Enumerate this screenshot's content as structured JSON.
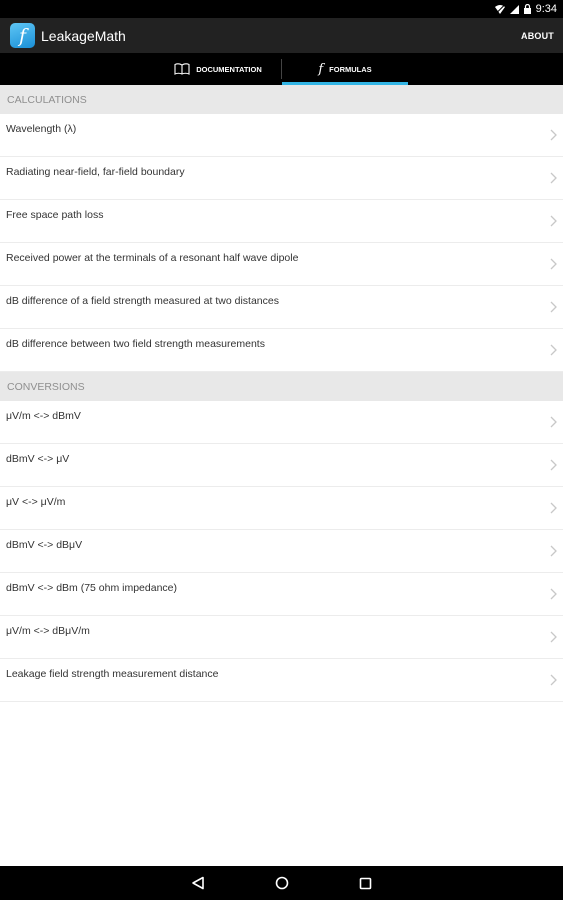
{
  "status_bar": {
    "time": "9:34"
  },
  "app": {
    "icon_letter": "f",
    "title": "LeakageMath",
    "about_label": "ABOUT"
  },
  "tabs": [
    {
      "label": "DOCUMENTATION",
      "icon": "book-icon",
      "selected": false
    },
    {
      "label": "FORMULAS",
      "icon": "function-icon",
      "selected": true
    }
  ],
  "sections": [
    {
      "title": "CALCULATIONS",
      "items": [
        "Wavelength (λ)",
        "Radiating near-field, far-field boundary",
        "Free space path loss",
        "Received power at the terminals of a resonant half wave dipole",
        "dB difference of a field strength measured at two distances",
        "dB difference between two field strength measurements"
      ]
    },
    {
      "title": "CONVERSIONS",
      "items": [
        "μV/m <-> dBmV",
        "dBmV <-> μV",
        "μV <-> μV/m",
        "dBmV <-> dBμV",
        "dBmV <-> dBm (75 ohm impedance)",
        "μV/m <-> dBμV/m",
        "Leakage field strength measurement distance"
      ]
    }
  ],
  "nav": [
    "back-icon",
    "home-icon",
    "recents-icon"
  ],
  "colors": {
    "accent": "#33b5e5",
    "action_bar": "#222222",
    "section_bg": "#e8e8e8"
  }
}
